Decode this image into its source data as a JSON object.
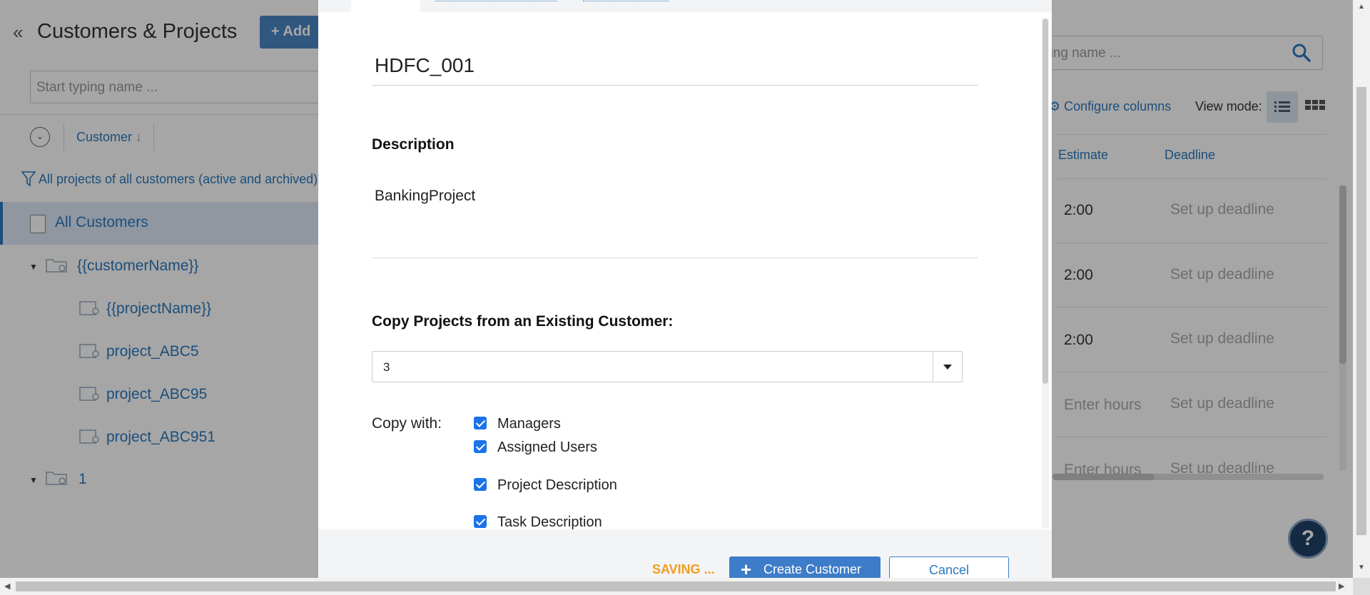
{
  "app": {
    "title": "Customers & Projects",
    "add_label": "Add",
    "search_placeholder": "Start typing name ...",
    "column_customer": "Customer",
    "filter_text": "All projects of all customers (active and archived)",
    "all_customers": "All Customers",
    "tree": [
      {
        "label": "{{customerName}}",
        "type": "customer"
      },
      {
        "label": "{{projectName}}",
        "type": "project"
      },
      {
        "label": "project_ABC5",
        "type": "project"
      },
      {
        "label": "project_ABC95",
        "type": "project"
      },
      {
        "label": "project_ABC951",
        "type": "project"
      },
      {
        "label": "1",
        "type": "customer"
      }
    ],
    "right_search_placeholder": "ping name ...",
    "configure_columns": "Configure columns",
    "view_mode": "View mode:",
    "columns": {
      "estimate": "Estimate",
      "deadline": "Deadline"
    },
    "rows": [
      {
        "estimate": "2:00",
        "deadline": "Set up deadline"
      },
      {
        "estimate": "2:00",
        "deadline": "Set up deadline"
      },
      {
        "estimate": "2:00",
        "deadline": "Set up deadline"
      },
      {
        "estimate": "Enter hours",
        "deadline": "Set up deadline"
      },
      {
        "estimate": "Enter hours",
        "deadline": "Set up deadline"
      }
    ],
    "help": "?"
  },
  "modal": {
    "customer_name": "HDFC_001",
    "description_label": "Description",
    "description": "BankingProject",
    "copy_label": "Copy Projects from an Existing Customer:",
    "copy_select_value": "3",
    "copy_with_label": "Copy with:",
    "copy_options": [
      {
        "label": "Managers",
        "checked": true
      },
      {
        "label": "Assigned Users",
        "checked": true
      },
      {
        "label": "Project Description",
        "checked": true
      },
      {
        "label": "Task Description",
        "checked": true
      }
    ],
    "saving": "SAVING ...",
    "create_label": "Create Customer",
    "cancel_label": "Cancel"
  },
  "colors": {
    "accent": "#2c79bd",
    "button": "#3d7cc9",
    "saving": "#f29c1f"
  }
}
